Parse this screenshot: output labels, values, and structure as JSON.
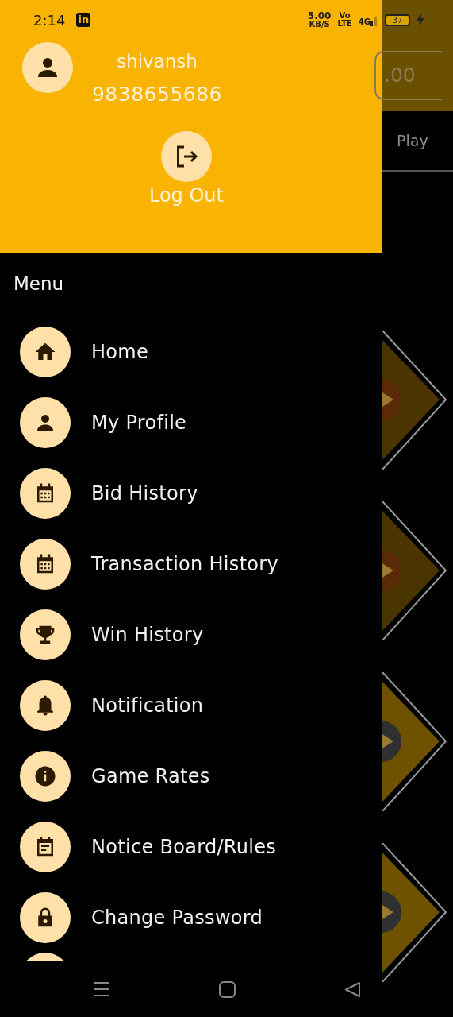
{
  "status_bar": {
    "time": "2:14",
    "app_badge": "in",
    "speed": "5.00",
    "speed_unit": "KB/S",
    "volte_top": "Vo",
    "volte_bottom": "LTE",
    "network": "4G",
    "battery": "37"
  },
  "profile": {
    "name": "shivansh",
    "phone": "9838655686",
    "logout_label": "Log Out"
  },
  "menu_title": "Menu",
  "menu_items": [
    {
      "label": "Home",
      "kind": "home"
    },
    {
      "label": "My Profile",
      "kind": "person"
    },
    {
      "label": "Bid History",
      "kind": "calendar"
    },
    {
      "label": "Transaction History",
      "kind": "calendar"
    },
    {
      "label": "Win History",
      "kind": "trophy"
    },
    {
      "label": "Notification",
      "kind": "bell"
    },
    {
      "label": "Game Rates",
      "kind": "info"
    },
    {
      "label": "Notice Board/Rules",
      "kind": "notes"
    },
    {
      "label": "Change Password",
      "kind": "lock"
    }
  ],
  "background_app": {
    "balance": ".00",
    "tab_label": "Play",
    "tiles": [
      {
        "kind": "dark"
      },
      {
        "kind": "dark"
      },
      {
        "kind": "gold"
      },
      {
        "kind": "gold"
      }
    ]
  }
}
